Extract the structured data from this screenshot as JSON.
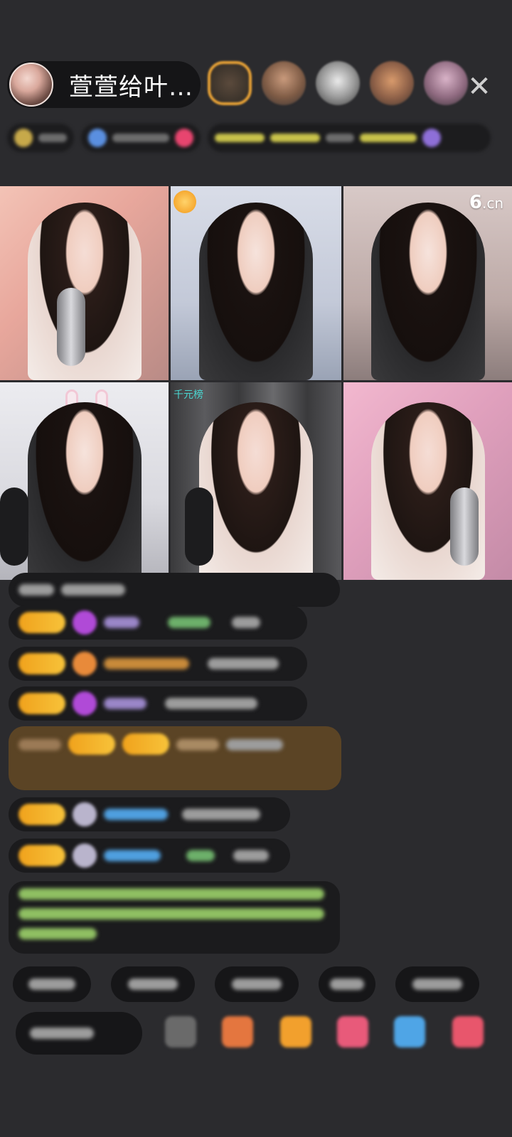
{
  "host": {
    "name": "萱萱给叶…",
    "avatar_icon": "host-avatar"
  },
  "close_icon": "✕",
  "grid": {
    "brand": "6",
    "brand_suffix": ".cn",
    "rank_tag": "千元榜",
    "tiles": [
      "streamer-1",
      "streamer-2",
      "streamer-3",
      "streamer-4",
      "streamer-5",
      "streamer-6"
    ]
  },
  "colors": {
    "background": "#2b2b2e",
    "level_badge": "#f0a21c",
    "gold_message": "#5b4425"
  }
}
